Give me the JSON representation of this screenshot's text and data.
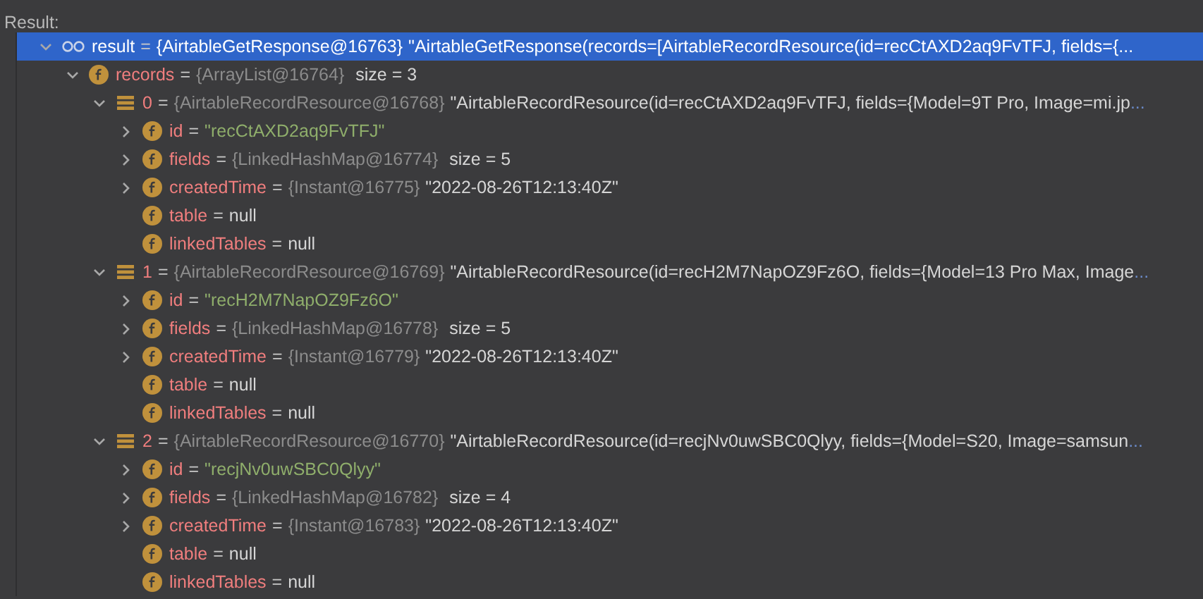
{
  "panel_title": "Result:",
  "tree": [
    {
      "kind": "watch",
      "name": "result",
      "eq": "=",
      "type": "{AirtableGetResponse@16763}",
      "value": {
        "kind": "plain",
        "text": "\"AirtableGetResponse(records=[AirtableRecordResource(id=recCtAXD2aq9FvTFJ, fields={..."
      },
      "expanded": true,
      "selected": true,
      "children": [
        {
          "kind": "field",
          "name": "records",
          "eq": "=",
          "type": "{ArrayList@16764}",
          "extra": "size = 3",
          "expanded": true,
          "selected": false,
          "children": [
            {
              "kind": "element",
              "name": "0",
              "eq": "=",
              "type": "{AirtableRecordResource@16768}",
              "value": {
                "kind": "plain",
                "text": "\"AirtableRecordResource(id=recCtAXD2aq9FvTFJ, fields={Model=9T Pro, Image=mi.jp"
              },
              "more": "...",
              "expanded": true,
              "selected": false,
              "children": [
                {
                  "kind": "field",
                  "name": "id",
                  "eq": "=",
                  "value": {
                    "kind": "string",
                    "text": "\"recCtAXD2aq9FvTFJ\""
                  },
                  "expanded": false,
                  "selected": false
                },
                {
                  "kind": "field",
                  "name": "fields",
                  "eq": "=",
                  "type": "{LinkedHashMap@16774}",
                  "extra": "size = 5",
                  "expanded": false,
                  "selected": false
                },
                {
                  "kind": "field",
                  "name": "createdTime",
                  "eq": "=",
                  "type": "{Instant@16775}",
                  "value": {
                    "kind": "plain",
                    "text": "\"2022-08-26T12:13:40Z\""
                  },
                  "expanded": false,
                  "selected": false
                },
                {
                  "kind": "field",
                  "name": "table",
                  "eq": "=",
                  "value": {
                    "kind": "plain",
                    "text": "null"
                  },
                  "selected": false
                },
                {
                  "kind": "field",
                  "name": "linkedTables",
                  "eq": "=",
                  "value": {
                    "kind": "plain",
                    "text": "null"
                  },
                  "selected": false
                }
              ]
            },
            {
              "kind": "element",
              "name": "1",
              "eq": "=",
              "type": "{AirtableRecordResource@16769}",
              "value": {
                "kind": "plain",
                "text": "\"AirtableRecordResource(id=recH2M7NapOZ9Fz6O, fields={Model=13 Pro Max, Image"
              },
              "more": "...",
              "expanded": true,
              "selected": false,
              "children": [
                {
                  "kind": "field",
                  "name": "id",
                  "eq": "=",
                  "value": {
                    "kind": "string",
                    "text": "\"recH2M7NapOZ9Fz6O\""
                  },
                  "expanded": false,
                  "selected": false
                },
                {
                  "kind": "field",
                  "name": "fields",
                  "eq": "=",
                  "type": "{LinkedHashMap@16778}",
                  "extra": "size = 5",
                  "expanded": false,
                  "selected": false
                },
                {
                  "kind": "field",
                  "name": "createdTime",
                  "eq": "=",
                  "type": "{Instant@16779}",
                  "value": {
                    "kind": "plain",
                    "text": "\"2022-08-26T12:13:40Z\""
                  },
                  "expanded": false,
                  "selected": false
                },
                {
                  "kind": "field",
                  "name": "table",
                  "eq": "=",
                  "value": {
                    "kind": "plain",
                    "text": "null"
                  },
                  "selected": false
                },
                {
                  "kind": "field",
                  "name": "linkedTables",
                  "eq": "=",
                  "value": {
                    "kind": "plain",
                    "text": "null"
                  },
                  "selected": false
                }
              ]
            },
            {
              "kind": "element",
              "name": "2",
              "eq": "=",
              "type": "{AirtableRecordResource@16770}",
              "value": {
                "kind": "plain",
                "text": "\"AirtableRecordResource(id=recjNv0uwSBC0Qlyy, fields={Model=S20, Image=samsun"
              },
              "more": "...",
              "expanded": true,
              "selected": false,
              "children": [
                {
                  "kind": "field",
                  "name": "id",
                  "eq": "=",
                  "value": {
                    "kind": "string",
                    "text": "\"recjNv0uwSBC0Qlyy\""
                  },
                  "expanded": false,
                  "selected": false
                },
                {
                  "kind": "field",
                  "name": "fields",
                  "eq": "=",
                  "type": "{LinkedHashMap@16782}",
                  "extra": "size = 4",
                  "expanded": false,
                  "selected": false
                },
                {
                  "kind": "field",
                  "name": "createdTime",
                  "eq": "=",
                  "type": "{Instant@16783}",
                  "value": {
                    "kind": "plain",
                    "text": "\"2022-08-26T12:13:40Z\""
                  },
                  "expanded": false,
                  "selected": false
                },
                {
                  "kind": "field",
                  "name": "table",
                  "eq": "=",
                  "value": {
                    "kind": "plain",
                    "text": "null"
                  },
                  "selected": false
                },
                {
                  "kind": "field",
                  "name": "linkedTables",
                  "eq": "=",
                  "value": {
                    "kind": "plain",
                    "text": "null"
                  },
                  "selected": false
                }
              ]
            }
          ]
        }
      ]
    }
  ]
}
